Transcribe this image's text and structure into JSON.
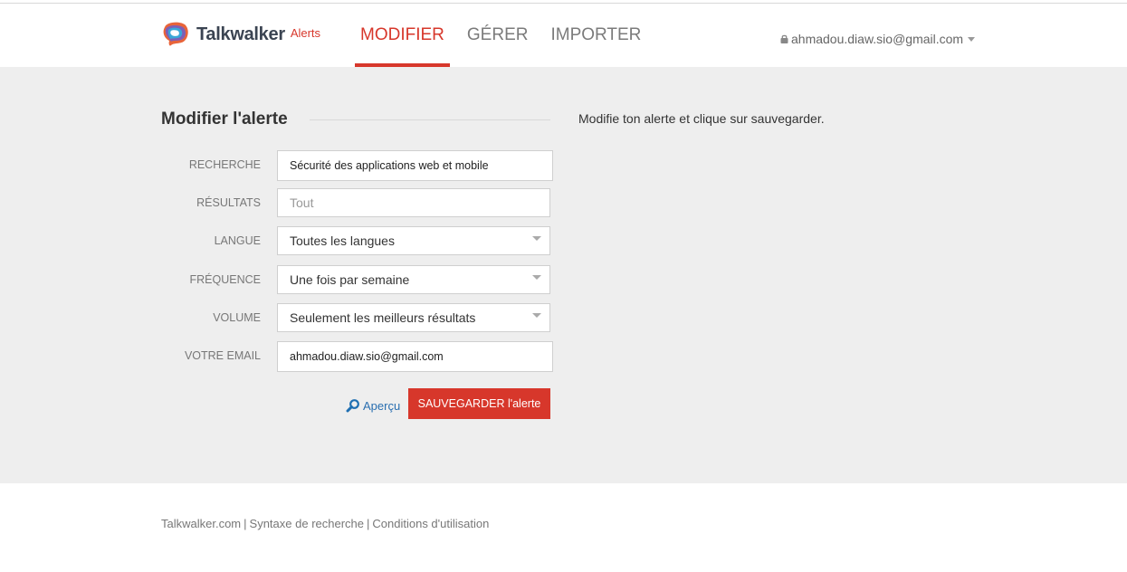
{
  "brand": {
    "name": "Talkwalker",
    "product": "Alerts",
    "accent_color": "#d7372b"
  },
  "nav": {
    "tabs": [
      {
        "label": "MODIFIER",
        "active": true
      },
      {
        "label": "GÉRER",
        "active": false
      },
      {
        "label": "IMPORTER",
        "active": false
      }
    ]
  },
  "account": {
    "email": "ahmadou.diaw.sio@gmail.com",
    "lock_icon": "lock-icon",
    "menu_icon": "chevron-down-icon"
  },
  "form": {
    "title": "Modifier l'alerte",
    "help_text": "Modifie ton alerte et clique sur sauvegarder.",
    "fields": {
      "search": {
        "label": "RECHERCHE",
        "value": "Sécurité des applications web et mobile"
      },
      "results": {
        "label": "RÉSULTATS",
        "placeholder": "Tout"
      },
      "language": {
        "label": "LANGUE",
        "value": "Toutes les langues"
      },
      "frequency": {
        "label": "FRÉQUENCE",
        "value": "Une fois par semaine"
      },
      "volume": {
        "label": "VOLUME",
        "value": "Seulement les meilleurs résultats"
      },
      "email": {
        "label": "VOTRE EMAIL",
        "value": "ahmadou.diaw.sio@gmail.com"
      }
    },
    "preview_label": "Aperçu",
    "save_label": "SAUVEGARDER l'alerte"
  },
  "footer": {
    "links": [
      "Talkwalker.com",
      "Syntaxe de recherche",
      "Conditions d'utilisation"
    ],
    "separator": "|"
  }
}
